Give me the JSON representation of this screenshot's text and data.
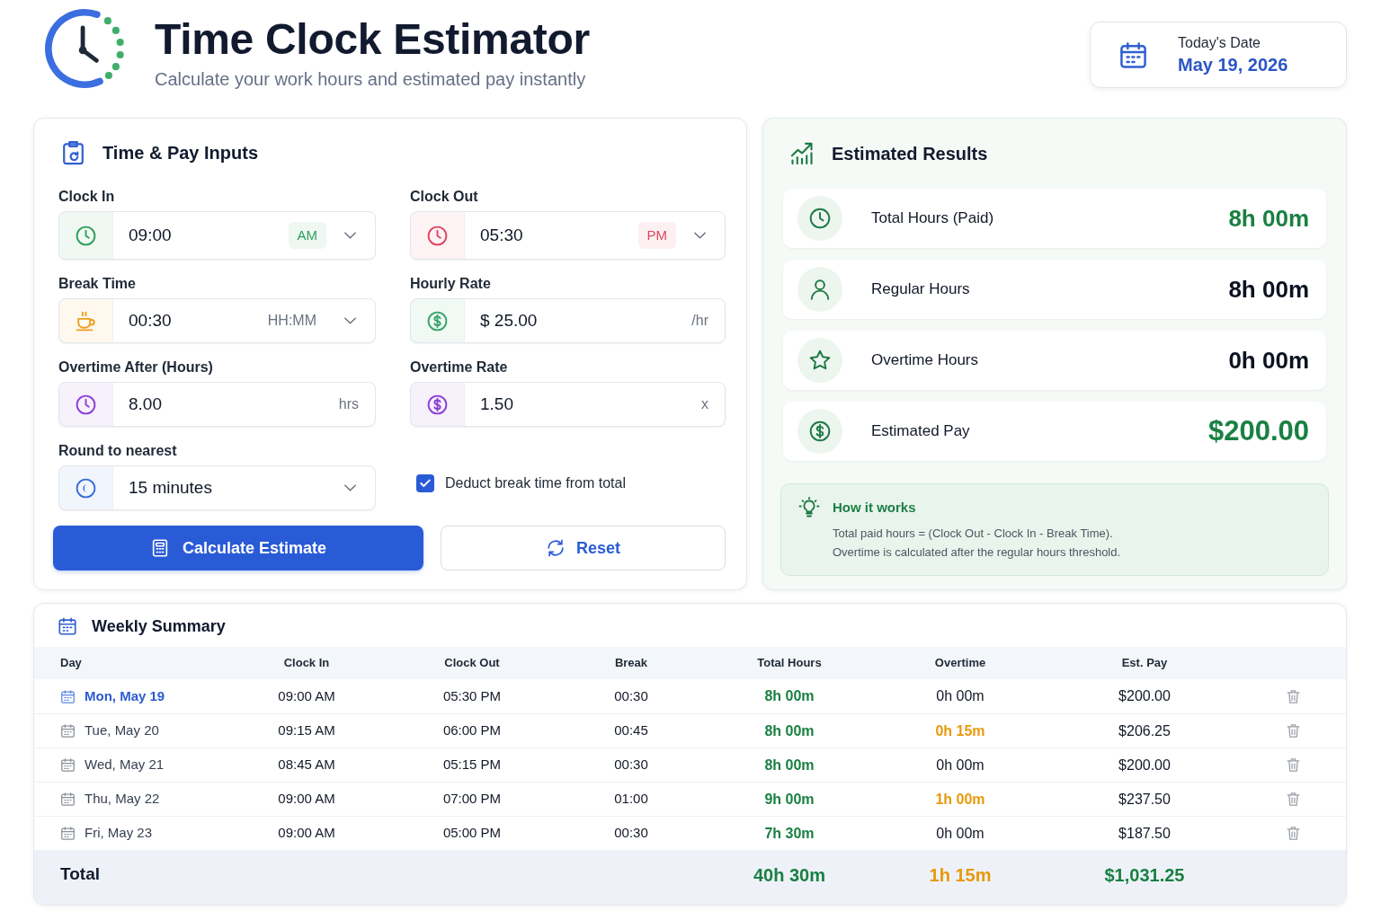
{
  "header": {
    "title": "Time Clock Estimator",
    "subtitle": "Calculate your work hours and estimated pay instantly"
  },
  "date_card": {
    "label": "Today's Date",
    "value": "May 19, 2026"
  },
  "inputs_panel": {
    "title": "Time & Pay Inputs",
    "fields": [
      {
        "label": "Clock In",
        "kind": "time",
        "value": "09:00",
        "suffix": "AM",
        "color": "#2e9e5b"
      },
      {
        "label": "Clock Out",
        "kind": "time",
        "value": "05:30",
        "suffix": "PM",
        "color": "#e0465e"
      },
      {
        "label": "Break Time",
        "kind": "duration",
        "value": "00:30",
        "suffix": "HH:MM",
        "color": "#ef9d1c"
      },
      {
        "label": "Hourly Rate",
        "kind": "number",
        "value": "$ 25.00",
        "suffix": "/hr",
        "color": "#36a56a"
      },
      {
        "label": "Overtime After (Hours)",
        "kind": "number",
        "value": "8.00",
        "suffix": "hrs",
        "color": "#8b3fd9"
      },
      {
        "label": "Overtime Rate",
        "kind": "number",
        "value": "1.50",
        "suffix": "x",
        "color": "#8b3fd9"
      },
      {
        "label": "Round to nearest",
        "kind": "select",
        "value": "15 minutes",
        "color": "#3b6fd8"
      }
    ],
    "checkbox": {
      "label": "Deduct break time from total",
      "checked": true
    },
    "buttons": [
      {
        "label": "Calculate Estimate",
        "kind": "primary"
      },
      {
        "label": "Reset",
        "kind": "secondary"
      }
    ]
  },
  "results_panel": {
    "title": "Estimated Results",
    "items": [
      {
        "label": "Total Hours (Paid)",
        "value": "8h 00m",
        "kind": "hours",
        "highlighted": true
      },
      {
        "label": "Regular Hours",
        "value": "8h 00m",
        "kind": "hours",
        "highlighted": false
      },
      {
        "label": "Overtime Hours",
        "value": "0h 00m",
        "kind": "hours",
        "highlighted": false
      },
      {
        "label": "Estimated Pay",
        "value": "$200.00",
        "kind": "pay",
        "highlighted": true
      }
    ],
    "note": {
      "title": "How it works",
      "lines": [
        "Total paid hours = (Clock Out - Clock In - Break Time).",
        "Overtime is calculated after the regular hours threshold."
      ]
    }
  },
  "weekly_summary": {
    "title": "Weekly Summary",
    "columns": [
      "Day",
      "Clock In",
      "Clock Out",
      "Break",
      "Total Hours",
      "Overtime",
      "Est. Pay"
    ],
    "rows": [
      {
        "day": "Mon, May 19",
        "clock_in": "09:00 AM",
        "clock_out": "05:30 PM",
        "break": "00:30",
        "total_hours": "8h 00m",
        "overtime": "0h 00m",
        "has_overtime": false,
        "est_pay": "$200.00",
        "selected": true
      },
      {
        "day": "Tue, May 20",
        "clock_in": "09:15 AM",
        "clock_out": "06:00 PM",
        "break": "00:45",
        "total_hours": "8h 00m",
        "overtime": "0h 15m",
        "has_overtime": true,
        "est_pay": "$206.25",
        "selected": false
      },
      {
        "day": "Wed, May 21",
        "clock_in": "08:45 AM",
        "clock_out": "05:15 PM",
        "break": "00:30",
        "total_hours": "8h 00m",
        "overtime": "0h 00m",
        "has_overtime": false,
        "est_pay": "$200.00",
        "selected": false
      },
      {
        "day": "Thu, May 22",
        "clock_in": "09:00 AM",
        "clock_out": "07:00 PM",
        "break": "01:00",
        "total_hours": "9h 00m",
        "overtime": "1h 00m",
        "has_overtime": true,
        "est_pay": "$237.50",
        "selected": false
      },
      {
        "day": "Fri, May 23",
        "clock_in": "09:00 AM",
        "clock_out": "05:00 PM",
        "break": "00:30",
        "total_hours": "7h 30m",
        "overtime": "0h 00m",
        "has_overtime": false,
        "est_pay": "$187.50",
        "selected": false
      }
    ],
    "total": {
      "label": "Total",
      "total_hours": "40h 30m",
      "overtime": "1h 15m",
      "has_overtime": true,
      "est_pay": "$1,031.25"
    }
  }
}
